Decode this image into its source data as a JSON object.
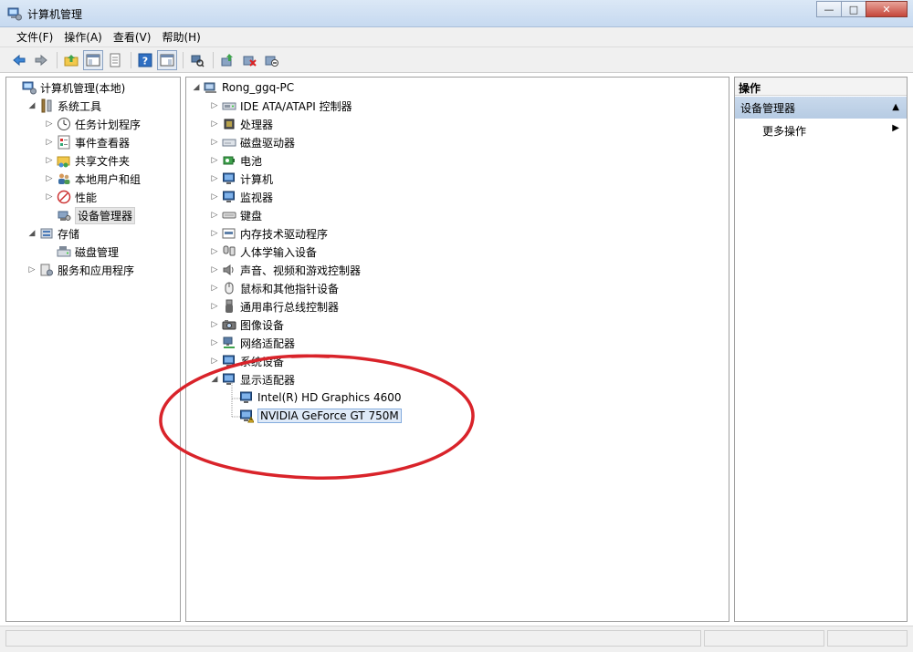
{
  "window": {
    "title": "计算机管理",
    "buttons": {
      "minimize": "—",
      "maximize": "□",
      "close": "✕"
    }
  },
  "menubar": [
    "文件(F)",
    "操作(A)",
    "查看(V)",
    "帮助(H)"
  ],
  "left_tree": [
    {
      "label": "计算机管理(本地)",
      "icon": "computer-management-icon",
      "level": 0,
      "expander": "none"
    },
    {
      "label": "系统工具",
      "icon": "tools-icon",
      "level": 1,
      "expander": "expanded"
    },
    {
      "label": "任务计划程序",
      "icon": "clock-icon",
      "level": 2,
      "expander": "collapsed"
    },
    {
      "label": "事件查看器",
      "icon": "event-viewer-icon",
      "level": 2,
      "expander": "collapsed"
    },
    {
      "label": "共享文件夹",
      "icon": "shared-folder-icon",
      "level": 2,
      "expander": "collapsed"
    },
    {
      "label": "本地用户和组",
      "icon": "users-icon",
      "level": 2,
      "expander": "collapsed"
    },
    {
      "label": "性能",
      "icon": "performance-icon",
      "level": 2,
      "expander": "collapsed"
    },
    {
      "label": "设备管理器",
      "icon": "device-manager-icon",
      "level": 2,
      "expander": "none",
      "selected": true
    },
    {
      "label": "存储",
      "icon": "storage-icon",
      "level": 1,
      "expander": "expanded"
    },
    {
      "label": "磁盘管理",
      "icon": "disk-management-icon",
      "level": 2,
      "expander": "none"
    },
    {
      "label": "服务和应用程序",
      "icon": "services-icon",
      "level": 1,
      "expander": "collapsed"
    }
  ],
  "device_tree": {
    "root": "Rong_ggq-PC",
    "categories": [
      "IDE ATA/ATAPI 控制器",
      "处理器",
      "磁盘驱动器",
      "电池",
      "计算机",
      "监视器",
      "键盘",
      "内存技术驱动程序",
      "人体学输入设备",
      "声音、视频和游戏控制器",
      "鼠标和其他指针设备",
      "通用串行总线控制器",
      "图像设备",
      "网络适配器",
      "系统设备",
      "显示适配器"
    ],
    "display_adapters": [
      {
        "label": "Intel(R) HD Graphics 4600",
        "warning": false
      },
      {
        "label": "NVIDIA GeForce GT 750M",
        "warning": true,
        "selected": true
      }
    ]
  },
  "actions": {
    "header": "操作",
    "section": "设备管理器",
    "more": "更多操作"
  },
  "colors": {
    "annotation": "#d9232a",
    "selection": "#dfeaf8"
  }
}
